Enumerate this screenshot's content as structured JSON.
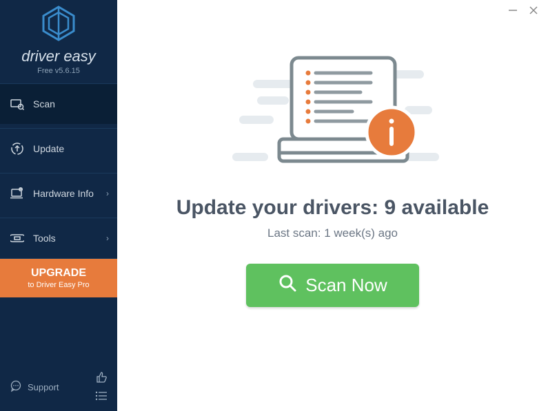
{
  "brand": {
    "name": "driver easy",
    "version": "Free v5.6.15"
  },
  "sidebar": {
    "items": [
      {
        "label": "Scan",
        "icon": "scan-icon",
        "active": true,
        "expandable": false
      },
      {
        "label": "Update",
        "icon": "update-icon",
        "active": false,
        "expandable": false
      },
      {
        "label": "Hardware Info",
        "icon": "hardware-icon",
        "active": false,
        "expandable": true
      },
      {
        "label": "Tools",
        "icon": "tools-icon",
        "active": false,
        "expandable": true
      }
    ],
    "upgrade": {
      "title": "UPGRADE",
      "subtitle": "to Driver Easy Pro"
    },
    "support_label": "Support"
  },
  "main": {
    "headline_prefix": "Update your drivers: ",
    "available_count": "9",
    "headline_suffix": " available",
    "last_scan_prefix": "Last scan: ",
    "last_scan_value": "1 week(s) ago",
    "scan_button": "Scan Now"
  }
}
